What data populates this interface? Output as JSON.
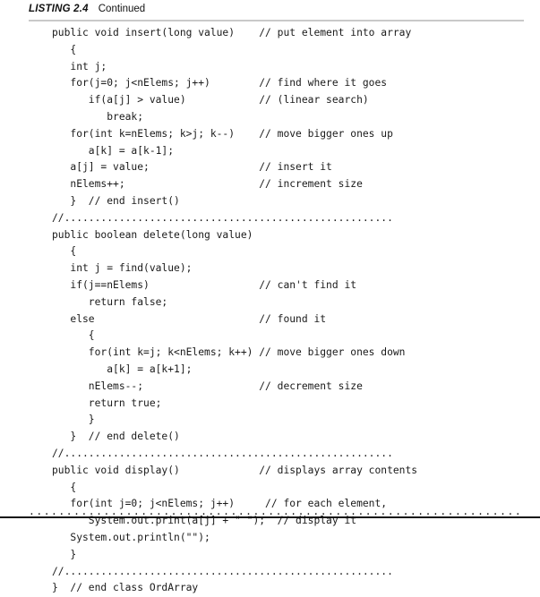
{
  "header": {
    "label": "LISTING 2.4",
    "caption": "Continued"
  },
  "code": {
    "lines": [
      "public void insert(long value)    // put element into array",
      "   {",
      "   int j;",
      "   for(j=0; j<nElems; j++)        // find where it goes",
      "      if(a[j] > value)            // (linear search)",
      "         break;",
      "   for(int k=nElems; k>j; k--)    // move bigger ones up",
      "      a[k] = a[k-1];",
      "   a[j] = value;                  // insert it",
      "   nElems++;                      // increment size",
      "   }  // end insert()",
      "//......................................................",
      "public boolean delete(long value)",
      "   {",
      "   int j = find(value);",
      "   if(j==nElems)                  // can't find it",
      "      return false;",
      "   else                           // found it",
      "      {",
      "      for(int k=j; k<nElems; k++) // move bigger ones down",
      "         a[k] = a[k+1];",
      "      nElems--;                   // decrement size",
      "      return true;",
      "      }",
      "   }  // end delete()",
      "//......................................................",
      "public void display()             // displays array contents",
      "   {",
      "   for(int j=0; j<nElems; j++)     // for each element,",
      "      System.out.print(a[j] + \" \");  // display it",
      "   System.out.println(\"\");",
      "   }",
      "//......................................................",
      "}  // end class OrdArray"
    ]
  },
  "footer": {
    "dots": "........................................................................"
  },
  "colors": {
    "page_background": "#ffffff",
    "text": "#1a1a1a",
    "header_rule": "#c9c9c9",
    "footer_rule": "#111111"
  }
}
